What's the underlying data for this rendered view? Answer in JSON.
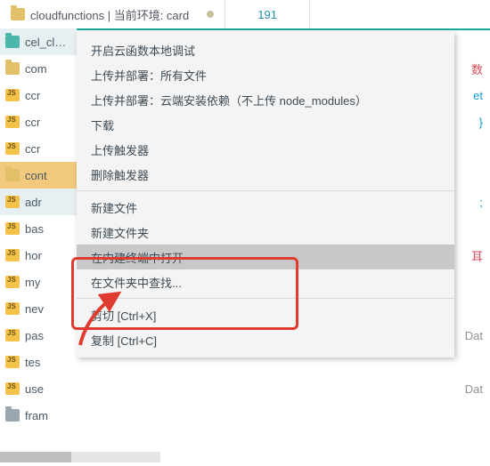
{
  "tab": {
    "icon": "folder",
    "title": "cloudfunctions | 当前环境: card",
    "modified": true
  },
  "counter": "191",
  "sidebar": [
    {
      "icon": "folder teal",
      "label": "cel_cl…",
      "sel": true
    },
    {
      "icon": "folder",
      "label": "com"
    },
    {
      "icon": "js",
      "label": "ccr"
    },
    {
      "icon": "js",
      "label": "ccr"
    },
    {
      "icon": "js",
      "label": "ccr"
    },
    {
      "icon": "folder",
      "label": "cont",
      "sel2": true
    },
    {
      "icon": "js",
      "label": "adr",
      "sel": true
    },
    {
      "icon": "js",
      "label": "bas"
    },
    {
      "icon": "js",
      "label": "hor"
    },
    {
      "icon": "js",
      "label": "my"
    },
    {
      "icon": "js",
      "label": "nev"
    },
    {
      "icon": "js",
      "label": "pas"
    },
    {
      "icon": "js",
      "label": "tes"
    },
    {
      "icon": "js",
      "label": "use"
    },
    {
      "icon": "folder grey",
      "label": "fram"
    }
  ],
  "gutter": [
    "",
    "数",
    "et",
    "}",
    "",
    "",
    "; ",
    "",
    "耳",
    "",
    "",
    "Dat",
    "",
    "Dat",
    "",
    ""
  ],
  "menu": {
    "g1": [
      "开启云函数本地调试",
      "上传并部署：所有文件",
      "上传并部署：云端安装依赖（不上传 node_modules）",
      "下载",
      "上传触发器",
      "删除触发器"
    ],
    "g2": [
      "新建文件",
      "新建文件夹",
      "在内建终端中打开",
      "在文件夹中查找..."
    ],
    "g3": [
      "剪切 [Ctrl+X]",
      "复制 [Ctrl+C]"
    ]
  },
  "highlight_index": 2
}
